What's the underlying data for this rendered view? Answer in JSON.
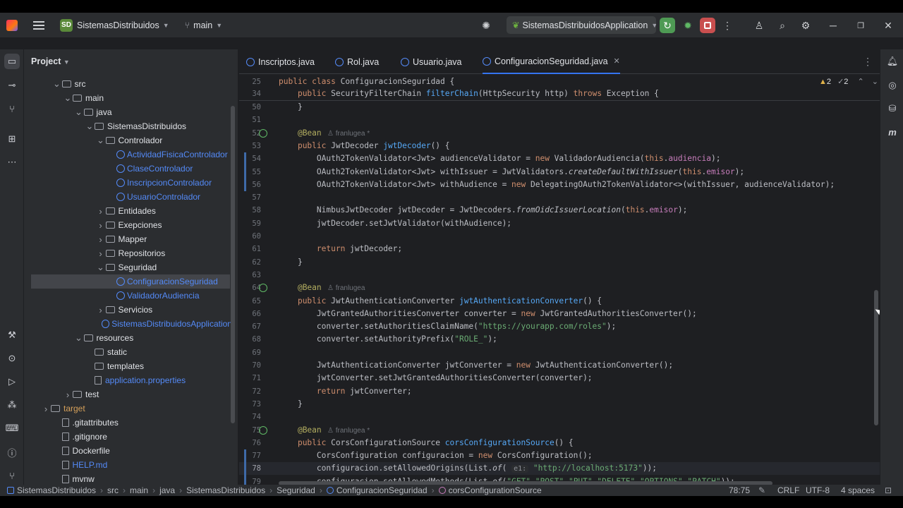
{
  "project": {
    "name": "SistemasDistribuidos",
    "badge": "SD",
    "branch": "main",
    "run_config": "SistemasDistribuidosApplication"
  },
  "panel": {
    "title": "Project",
    "tree": [
      {
        "label": "src",
        "kind": "folder",
        "expanded": true
      },
      {
        "label": "main",
        "kind": "folder",
        "expanded": true
      },
      {
        "label": "java",
        "kind": "folder",
        "expanded": true
      },
      {
        "label": "SistemasDistribuidos",
        "kind": "folder",
        "expanded": true
      },
      {
        "label": "Controlador",
        "kind": "folder",
        "expanded": true
      },
      {
        "label": "ActividadFisicaControlador",
        "kind": "class"
      },
      {
        "label": "ClaseControlador",
        "kind": "class"
      },
      {
        "label": "InscripcionControlador",
        "kind": "class"
      },
      {
        "label": "UsuarioControlador",
        "kind": "class"
      },
      {
        "label": "Entidades",
        "kind": "folder",
        "expanded": false
      },
      {
        "label": "Exepciones",
        "kind": "folder",
        "expanded": false
      },
      {
        "label": "Mapper",
        "kind": "folder",
        "expanded": false
      },
      {
        "label": "Repositorios",
        "kind": "folder",
        "expanded": false
      },
      {
        "label": "Seguridad",
        "kind": "folder",
        "expanded": true
      },
      {
        "label": "ConfiguracionSeguridad",
        "kind": "class",
        "selected": true
      },
      {
        "label": "ValidadorAudiencia",
        "kind": "class"
      },
      {
        "label": "Servicios",
        "kind": "folder",
        "expanded": false
      },
      {
        "label": "SistemasDistribuidosApplication",
        "kind": "class"
      },
      {
        "label": "resources",
        "kind": "folder",
        "expanded": true
      },
      {
        "label": "static",
        "kind": "folder"
      },
      {
        "label": "templates",
        "kind": "folder"
      },
      {
        "label": "application.properties",
        "kind": "file"
      },
      {
        "label": "test",
        "kind": "folder",
        "expanded": false
      },
      {
        "label": "target",
        "kind": "folder",
        "expanded": false
      },
      {
        "label": ".gitattributes",
        "kind": "file"
      },
      {
        "label": ".gitignore",
        "kind": "file"
      },
      {
        "label": "Dockerfile",
        "kind": "file"
      },
      {
        "label": "HELP.md",
        "kind": "file"
      },
      {
        "label": "mvnw",
        "kind": "file"
      }
    ]
  },
  "tabs": [
    {
      "label": "Inscriptos.java"
    },
    {
      "label": "Rol.java"
    },
    {
      "label": "Usuario.java"
    },
    {
      "label": "ConfiguracionSeguridad.java",
      "close": "✕"
    }
  ],
  "inspections": {
    "warnings": "2",
    "weak": "2"
  },
  "sticky": [
    {
      "n": "25",
      "code": "public class ConfiguracionSeguridad {"
    },
    {
      "n": "34",
      "code": "    public SecurityFilterChain filterChain(HttpSecurity http) throws Exception {"
    }
  ],
  "code": [
    {
      "n": "50",
      "code": "    }"
    },
    {
      "n": "51",
      "code": ""
    },
    {
      "n": "52",
      "code": "    @Bean",
      "author": "franlugea *"
    },
    {
      "n": "53",
      "code": "    public JwtDecoder jwtDecoder() {"
    },
    {
      "n": "54",
      "code": "        OAuth2TokenValidator<Jwt> audienceValidator = new ValidadorAudiencia(this.audiencia);"
    },
    {
      "n": "55",
      "code": "        OAuth2TokenValidator<Jwt> withIssuer = JwtValidators.createDefaultWithIssuer(this.emisor);"
    },
    {
      "n": "56",
      "code": "        OAuth2TokenValidator<Jwt> withAudience = new DelegatingOAuth2TokenValidator<>(withIssuer, audienceValidator);"
    },
    {
      "n": "57",
      "code": ""
    },
    {
      "n": "58",
      "code": "        NimbusJwtDecoder jwtDecoder = JwtDecoders.fromOidcIssuerLocation(this.emisor);"
    },
    {
      "n": "59",
      "code": "        jwtDecoder.setJwtValidator(withAudience);"
    },
    {
      "n": "60",
      "code": ""
    },
    {
      "n": "61",
      "code": "        return jwtDecoder;"
    },
    {
      "n": "62",
      "code": "    }"
    },
    {
      "n": "63",
      "code": ""
    },
    {
      "n": "64",
      "code": "    @Bean",
      "author": "franlugea"
    },
    {
      "n": "65",
      "code": "    public JwtAuthenticationConverter jwtAuthenticationConverter() {"
    },
    {
      "n": "66",
      "code": "        JwtGrantedAuthoritiesConverter converter = new JwtGrantedAuthoritiesConverter();"
    },
    {
      "n": "67",
      "code": "        converter.setAuthoritiesClaimName(\"https://yourapp.com/roles\");"
    },
    {
      "n": "68",
      "code": "        converter.setAuthorityPrefix(\"ROLE_\");"
    },
    {
      "n": "69",
      "code": ""
    },
    {
      "n": "70",
      "code": "        JwtAuthenticationConverter jwtConverter = new JwtAuthenticationConverter();"
    },
    {
      "n": "71",
      "code": "        jwtConverter.setJwtGrantedAuthoritiesConverter(converter);"
    },
    {
      "n": "72",
      "code": "        return jwtConverter;"
    },
    {
      "n": "73",
      "code": "    }"
    },
    {
      "n": "74",
      "code": ""
    },
    {
      "n": "75",
      "code": "    @Bean",
      "author": "franlugea *"
    },
    {
      "n": "76",
      "code": "    public CorsConfigurationSource corsConfigurationSource() {"
    },
    {
      "n": "77",
      "code": "        CorsConfiguration configuracion = new CorsConfiguration();"
    },
    {
      "n": "78",
      "code": "        configuracion.setAllowedOrigins(List.of( e1: \"http://localhost:5173\"));"
    },
    {
      "n": "79",
      "code": "        configuracion.setAllowedMethods(List.of(\"GET\",\"POST\",\"PUT\",\"DELETE\",\"OPTIONS\",\"PATCH\"));"
    }
  ],
  "status": {
    "breadcrumbs": [
      "SistemasDistribuidos",
      "src",
      "main",
      "java",
      "SistemasDistribuidos",
      "Seguridad",
      "ConfiguracionSeguridad",
      "corsConfigurationSource"
    ],
    "position": "78:75",
    "line_sep": "CRLF",
    "encoding": "UTF-8",
    "indent": "4 spaces"
  }
}
